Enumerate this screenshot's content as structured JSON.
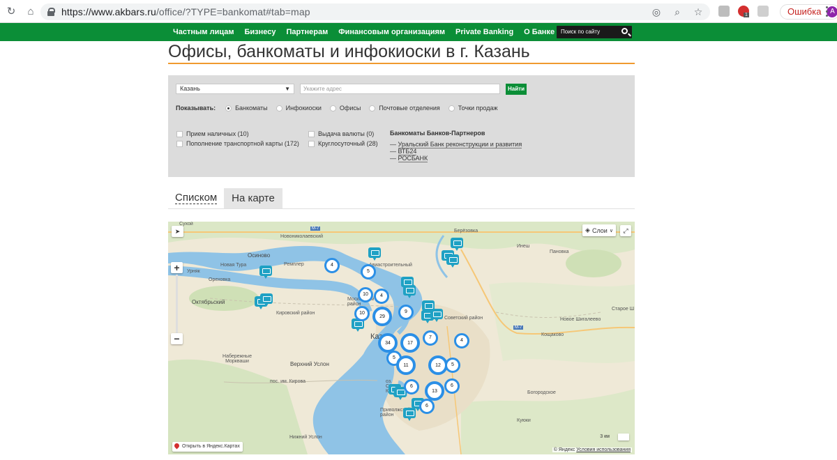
{
  "browser": {
    "url_host": "https://www.akbars.ru",
    "url_path": "/office/?TYPE=bankomat#tab=map",
    "error_label": "Ошибка",
    "avatar_letter": "A",
    "ext_badge": "1"
  },
  "nav": {
    "items": [
      "Частным лицам",
      "Бизнесу",
      "Партнерам",
      "Финансовым организациям",
      "Private Banking",
      "О Банке"
    ],
    "search_placeholder": "Поиск по сайту"
  },
  "page": {
    "title": "Офисы, банкоматы и инфокиоски в г. Казань"
  },
  "filters": {
    "city": "Казань",
    "address_placeholder": "Укажите адрес",
    "find_label": "Найти",
    "show_label": "Показывать:",
    "show_options": [
      "Банкоматы",
      "Инфокиоски",
      "Офисы",
      "Почтовые отделения",
      "Точки продаж"
    ],
    "show_selected": "Банкоматы",
    "checkboxes": [
      "Прием наличных (10)",
      "Пополнение транспортной карты (172)",
      "Выдача валюты (0)",
      "Круглосуточный (28)"
    ],
    "partners_title": "Банкоматы Банков-Партнеров",
    "partners": [
      "Уральский Банк реконструкции и развития",
      "ВТБ24",
      "РОСБАНК"
    ]
  },
  "tabs": {
    "list": "Списком",
    "map": "На карте"
  },
  "map": {
    "layers_label": "Слои",
    "open_yandex": "Открыть в Яндекс.Картах",
    "copyright": "© Яндекс",
    "terms": "Условия использования",
    "scale": "3 км",
    "zoom_in": "+",
    "zoom_out": "−",
    "labels": [
      "Новониколаевский",
      "Берёзовка",
      "Инеш",
      "Пановка",
      "Осиново",
      "Новая Тура",
      "Ремплер",
      "Урняк",
      "Ореховка",
      "Октябрьский",
      "Кировский район",
      "Московский район",
      "Советский район",
      "Старое Ш",
      "Новое Шигалеево",
      "Кощаково",
      "Набережные Моркваши",
      "Верхний Услон",
      "пос. им. Кирова",
      "Богородское",
      "Приволжский район",
      "Куюки",
      "Нижний Услон",
      "М-7",
      "М-7",
      "Авиастроительный",
      "Каз",
      "оз. Сред Кабан",
      "Сухой"
    ],
    "clusters": [
      "4",
      "5",
      "10",
      "4",
      "10",
      "29",
      "9",
      "34",
      "17",
      "7",
      "4",
      "5",
      "11",
      "12",
      "5",
      "6",
      "6",
      "13",
      "6"
    ]
  },
  "colors": {
    "brand_green": "#0b8e37",
    "accent_orange": "#f09a2f",
    "cluster_blue": "#2b8fe6",
    "pin_teal": "#1fa1c4"
  }
}
